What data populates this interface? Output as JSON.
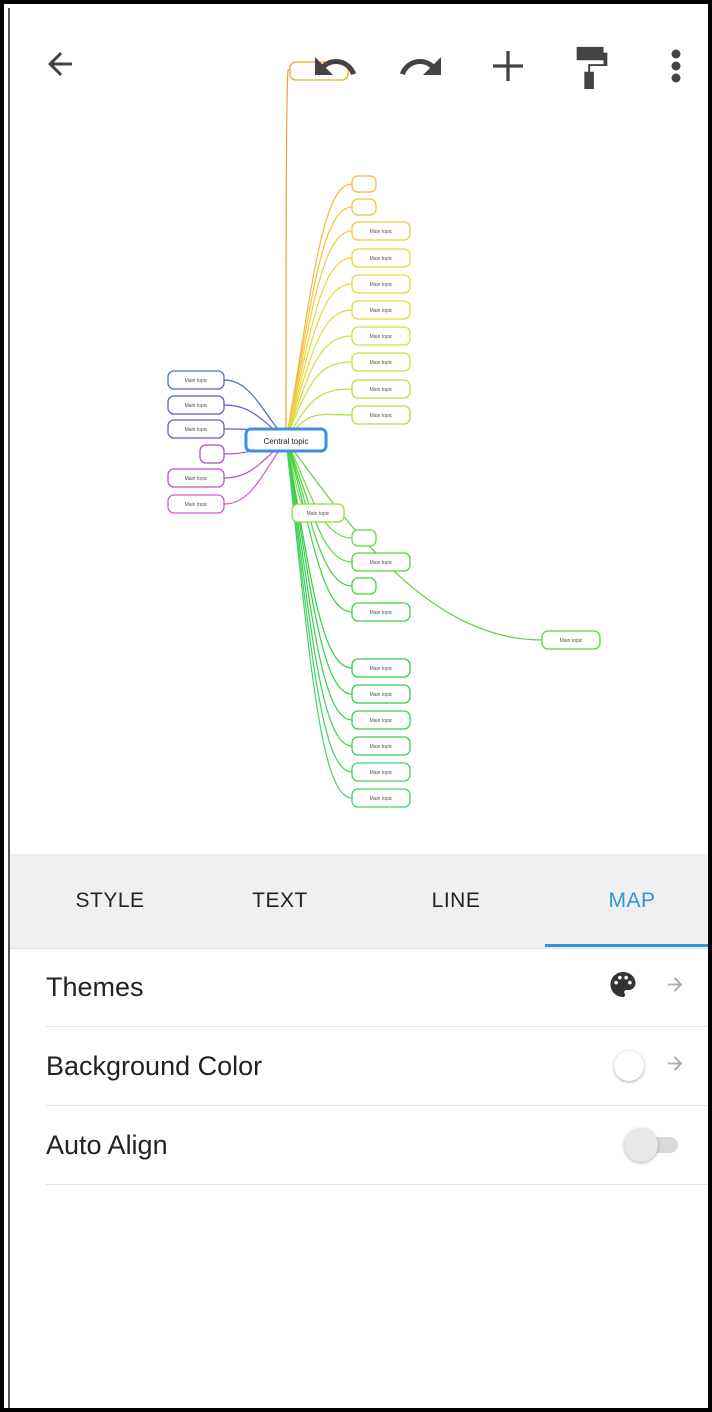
{
  "toolbar": {
    "back_icon": "arrow-left-icon",
    "undo_icon": "undo-icon",
    "redo_icon": "redo-icon",
    "add_icon": "plus-icon",
    "format_icon": "paint-roller-icon",
    "more_icon": "more-vert-icon"
  },
  "mindmap": {
    "central_topic": "Central topic",
    "topic_label": "Main topic"
  },
  "tabs": [
    {
      "label": "STYLE",
      "active": false
    },
    {
      "label": "TEXT",
      "active": false
    },
    {
      "label": "LINE",
      "active": false
    },
    {
      "label": "MAP",
      "active": true
    }
  ],
  "settings": {
    "themes": {
      "label": "Themes",
      "icon": "palette-icon"
    },
    "background_color": {
      "label": "Background Color",
      "value_color": "#ffffff"
    },
    "auto_align": {
      "label": "Auto Align",
      "enabled": false
    }
  },
  "colors": {
    "accent": "#2b95dd"
  }
}
